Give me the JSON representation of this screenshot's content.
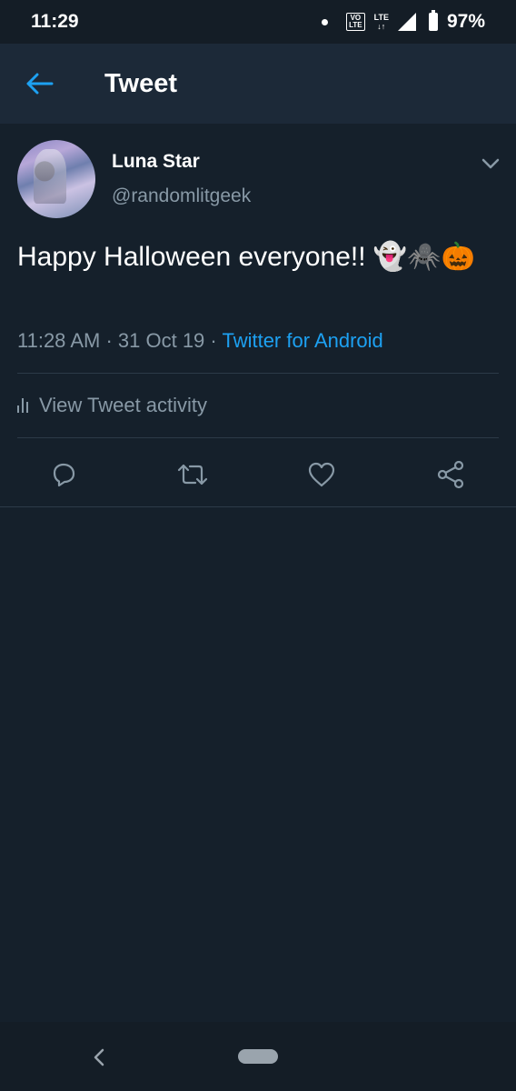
{
  "status_bar": {
    "time": "11:29",
    "volte_label": "VO LTE",
    "lte_label": "LTE",
    "battery_percent": "97%"
  },
  "app_bar": {
    "title": "Tweet",
    "back_icon": "arrow-left-icon"
  },
  "tweet": {
    "author_name": "Luna Star",
    "author_handle": "@randomlitgeek",
    "text": "Happy Halloween everyone!! 👻🕷️🎃",
    "time": "11:28 AM",
    "date": "31 Oct 19",
    "source": "Twitter for Android",
    "activity_label": "View Tweet activity"
  },
  "actions": [
    {
      "name": "reply",
      "icon": "reply-icon"
    },
    {
      "name": "retweet",
      "icon": "retweet-icon"
    },
    {
      "name": "like",
      "icon": "heart-icon"
    },
    {
      "name": "share",
      "icon": "share-icon"
    }
  ],
  "colors": {
    "background": "#15202b",
    "app_bar": "#1c2938",
    "accent": "#1da1f2",
    "secondary_text": "#8899a6"
  }
}
